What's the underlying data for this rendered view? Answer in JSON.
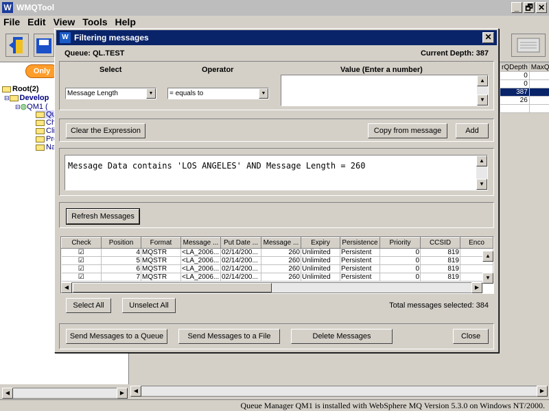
{
  "app": {
    "title": "WMQTool",
    "window_controls": [
      "_",
      "🗗",
      "✕"
    ],
    "menu": [
      "File",
      "Edit",
      "View",
      "Tools",
      "Help"
    ]
  },
  "left": {
    "only_button": "Only",
    "tree": [
      {
        "label": "Root(2)",
        "level": 0
      },
      {
        "label": "Develop",
        "level": 1
      },
      {
        "label": "QM1 (",
        "level": 2
      },
      {
        "label": "Qu",
        "level": 3
      },
      {
        "label": "Ch",
        "level": 3
      },
      {
        "label": "Cli",
        "level": 3
      },
      {
        "label": "Pro",
        "level": 3
      },
      {
        "label": "Na",
        "level": 3
      }
    ]
  },
  "right_grid": {
    "headers": [
      "rQDepth",
      "MaxQ"
    ],
    "rows": [
      [
        "0",
        ""
      ],
      [
        "0",
        ""
      ],
      [
        "387",
        ""
      ],
      [
        "26",
        ""
      ],
      [
        "",
        ""
      ]
    ]
  },
  "dialog": {
    "title": "Filtering messages",
    "close": "✕",
    "queue_label": "Queue: QL.TEST",
    "depth_label": "Current Depth: 387",
    "headers": {
      "select": "Select",
      "operator": "Operator",
      "value": "Value (Enter a number)"
    },
    "select_value": "Message Length",
    "operator_value": "= equals to",
    "buttons": {
      "clear": "Clear the Expression",
      "copy": "Copy from message",
      "add": "Add",
      "refresh": "Refresh Messages",
      "select_all": "Select All",
      "unselect_all": "Unselect All",
      "send_queue": "Send Messages to a Queue",
      "send_file": "Send Messages to a File",
      "delete": "Delete Messages",
      "close": "Close"
    },
    "expression": "Message Data contains 'LOS ANGELES' AND Message Length = 260",
    "table": {
      "columns": [
        "Check",
        "Position",
        "Format",
        "Message ...",
        "Put Date ...",
        "Message ...",
        "Expiry",
        "Persistence",
        "Priority",
        "CCSID",
        "Enco"
      ],
      "rows": [
        [
          "☑",
          "4",
          "MQSTR",
          "<LA_2006...",
          "02/14/200...",
          "260",
          "Unlimited",
          "Persistent",
          "0",
          "819",
          ""
        ],
        [
          "☑",
          "5",
          "MQSTR",
          "<LA_2006...",
          "02/14/200...",
          "260",
          "Unlimited",
          "Persistent",
          "0",
          "819",
          ""
        ],
        [
          "☑",
          "6",
          "MQSTR",
          "<LA_2006...",
          "02/14/200...",
          "260",
          "Unlimited",
          "Persistent",
          "0",
          "819",
          ""
        ],
        [
          "☑",
          "7",
          "MQSTR",
          "<LA_2006...",
          "02/14/200...",
          "260",
          "Unlimited",
          "Persistent",
          "0",
          "819",
          ""
        ]
      ]
    },
    "total_selected": "Total messages selected: 384"
  },
  "status": "Queue Manager QM1 is installed with WebSphere MQ Version 5.3.0 on Windows NT/2000."
}
